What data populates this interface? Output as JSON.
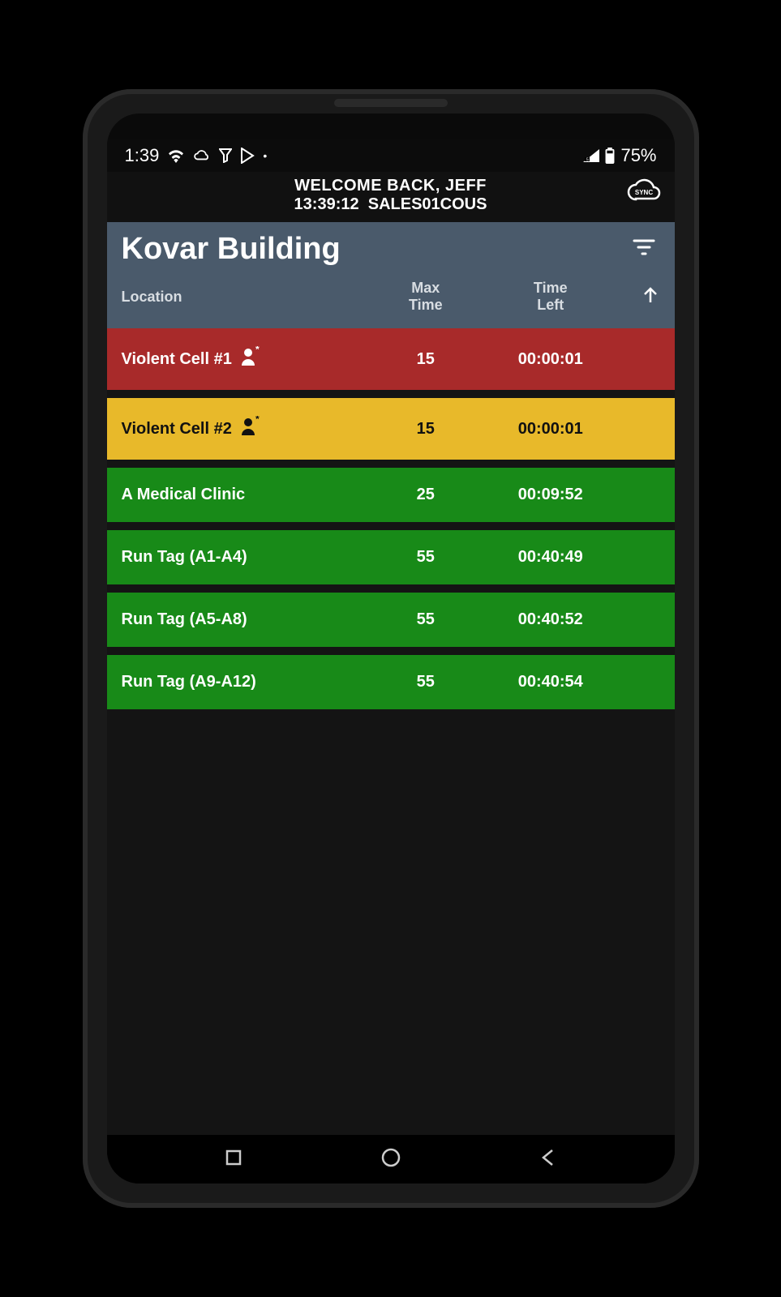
{
  "status": {
    "time": "1:39",
    "battery": "75%"
  },
  "header": {
    "welcome": "WELCOME BACK, JEFF",
    "time": "13:39:12",
    "device_id": "SALES01COUS",
    "sync_label": "SYNC"
  },
  "title": "Kovar Building",
  "columns": {
    "location": "Location",
    "max_time": "Max Time",
    "time_left": "Time Left"
  },
  "rows": [
    {
      "location": "Violent Cell #1",
      "max_time": "15",
      "time_left": "00:00:01",
      "status": "red",
      "icon": true
    },
    {
      "location": "Violent Cell #2",
      "max_time": "15",
      "time_left": "00:00:01",
      "status": "yellow",
      "icon": true
    },
    {
      "location": "A Medical Clinic",
      "max_time": "25",
      "time_left": "00:09:52",
      "status": "green",
      "icon": false
    },
    {
      "location": "Run Tag (A1-A4)",
      "max_time": "55",
      "time_left": "00:40:49",
      "status": "green",
      "icon": false
    },
    {
      "location": "Run Tag (A5-A8)",
      "max_time": "55",
      "time_left": "00:40:52",
      "status": "green",
      "icon": false
    },
    {
      "location": "Run Tag (A9-A12)",
      "max_time": "55",
      "time_left": "00:40:54",
      "status": "green",
      "icon": false
    }
  ],
  "colors": {
    "red": "#a82a2a",
    "yellow": "#e8b92a",
    "green": "#188a18",
    "header_bg": "#4a5a6b"
  }
}
